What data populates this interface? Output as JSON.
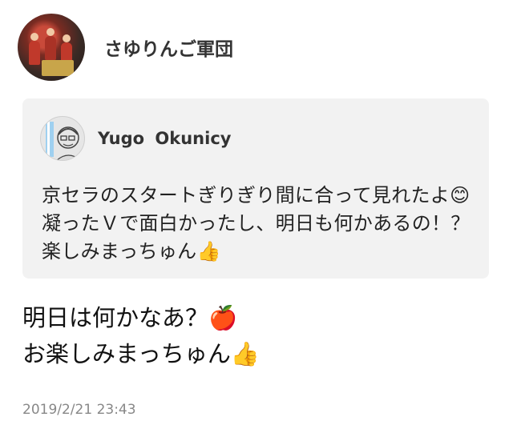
{
  "post": {
    "author": "さゆりんご軍団",
    "quote": {
      "author": "Yugo  Okunicy",
      "text": "京セラのスタートぎりぎり間に合って見れたよ😊凝ったＶで面白かったし、明日も何かあるの！？楽しみまっちゅん👍"
    },
    "body_lines": [
      "明日は何かなあ？🍎",
      "お楽しみまっちゅん👍"
    ],
    "timestamp": "2019/2/21 23:43"
  }
}
